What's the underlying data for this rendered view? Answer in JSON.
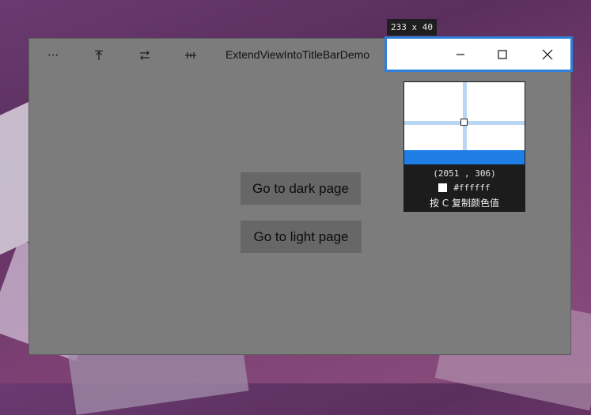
{
  "app": {
    "title": "ExtendViewIntoTitleBarDemo",
    "toolbar_icons": [
      "more-icon",
      "move-to-top-icon",
      "swap-icon",
      "fit-width-icon"
    ],
    "more_glyph": "···"
  },
  "main": {
    "dark_button": "Go to dark page",
    "light_button": "Go to light page"
  },
  "capture": {
    "size_label": "233 x 40",
    "accent_color": "#2e80d8",
    "caption_icons": [
      "minimize-icon",
      "maximize-icon",
      "close-icon"
    ]
  },
  "magnifier": {
    "coords": "(2051 , 306)",
    "color_hex": "#ffffff",
    "hint": "按 C 复制颜色值"
  }
}
